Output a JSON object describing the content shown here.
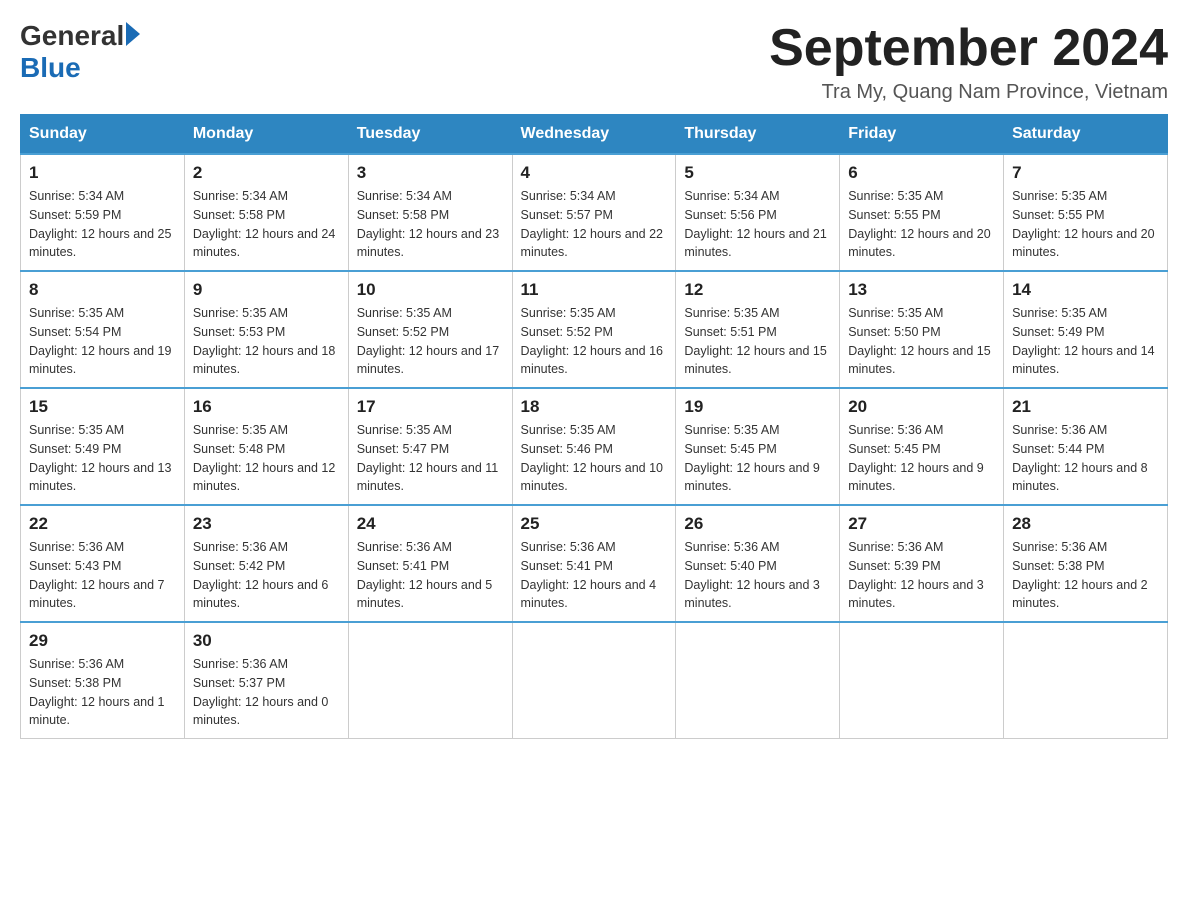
{
  "header": {
    "logo_general": "General",
    "logo_blue": "Blue",
    "month_title": "September 2024",
    "location": "Tra My, Quang Nam Province, Vietnam"
  },
  "days_of_week": [
    "Sunday",
    "Monday",
    "Tuesday",
    "Wednesday",
    "Thursday",
    "Friday",
    "Saturday"
  ],
  "weeks": [
    [
      {
        "day": "1",
        "sunrise": "5:34 AM",
        "sunset": "5:59 PM",
        "daylight": "12 hours and 25 minutes."
      },
      {
        "day": "2",
        "sunrise": "5:34 AM",
        "sunset": "5:58 PM",
        "daylight": "12 hours and 24 minutes."
      },
      {
        "day": "3",
        "sunrise": "5:34 AM",
        "sunset": "5:58 PM",
        "daylight": "12 hours and 23 minutes."
      },
      {
        "day": "4",
        "sunrise": "5:34 AM",
        "sunset": "5:57 PM",
        "daylight": "12 hours and 22 minutes."
      },
      {
        "day": "5",
        "sunrise": "5:34 AM",
        "sunset": "5:56 PM",
        "daylight": "12 hours and 21 minutes."
      },
      {
        "day": "6",
        "sunrise": "5:35 AM",
        "sunset": "5:55 PM",
        "daylight": "12 hours and 20 minutes."
      },
      {
        "day": "7",
        "sunrise": "5:35 AM",
        "sunset": "5:55 PM",
        "daylight": "12 hours and 20 minutes."
      }
    ],
    [
      {
        "day": "8",
        "sunrise": "5:35 AM",
        "sunset": "5:54 PM",
        "daylight": "12 hours and 19 minutes."
      },
      {
        "day": "9",
        "sunrise": "5:35 AM",
        "sunset": "5:53 PM",
        "daylight": "12 hours and 18 minutes."
      },
      {
        "day": "10",
        "sunrise": "5:35 AM",
        "sunset": "5:52 PM",
        "daylight": "12 hours and 17 minutes."
      },
      {
        "day": "11",
        "sunrise": "5:35 AM",
        "sunset": "5:52 PM",
        "daylight": "12 hours and 16 minutes."
      },
      {
        "day": "12",
        "sunrise": "5:35 AM",
        "sunset": "5:51 PM",
        "daylight": "12 hours and 15 minutes."
      },
      {
        "day": "13",
        "sunrise": "5:35 AM",
        "sunset": "5:50 PM",
        "daylight": "12 hours and 15 minutes."
      },
      {
        "day": "14",
        "sunrise": "5:35 AM",
        "sunset": "5:49 PM",
        "daylight": "12 hours and 14 minutes."
      }
    ],
    [
      {
        "day": "15",
        "sunrise": "5:35 AM",
        "sunset": "5:49 PM",
        "daylight": "12 hours and 13 minutes."
      },
      {
        "day": "16",
        "sunrise": "5:35 AM",
        "sunset": "5:48 PM",
        "daylight": "12 hours and 12 minutes."
      },
      {
        "day": "17",
        "sunrise": "5:35 AM",
        "sunset": "5:47 PM",
        "daylight": "12 hours and 11 minutes."
      },
      {
        "day": "18",
        "sunrise": "5:35 AM",
        "sunset": "5:46 PM",
        "daylight": "12 hours and 10 minutes."
      },
      {
        "day": "19",
        "sunrise": "5:35 AM",
        "sunset": "5:45 PM",
        "daylight": "12 hours and 9 minutes."
      },
      {
        "day": "20",
        "sunrise": "5:36 AM",
        "sunset": "5:45 PM",
        "daylight": "12 hours and 9 minutes."
      },
      {
        "day": "21",
        "sunrise": "5:36 AM",
        "sunset": "5:44 PM",
        "daylight": "12 hours and 8 minutes."
      }
    ],
    [
      {
        "day": "22",
        "sunrise": "5:36 AM",
        "sunset": "5:43 PM",
        "daylight": "12 hours and 7 minutes."
      },
      {
        "day": "23",
        "sunrise": "5:36 AM",
        "sunset": "5:42 PM",
        "daylight": "12 hours and 6 minutes."
      },
      {
        "day": "24",
        "sunrise": "5:36 AM",
        "sunset": "5:41 PM",
        "daylight": "12 hours and 5 minutes."
      },
      {
        "day": "25",
        "sunrise": "5:36 AM",
        "sunset": "5:41 PM",
        "daylight": "12 hours and 4 minutes."
      },
      {
        "day": "26",
        "sunrise": "5:36 AM",
        "sunset": "5:40 PM",
        "daylight": "12 hours and 3 minutes."
      },
      {
        "day": "27",
        "sunrise": "5:36 AM",
        "sunset": "5:39 PM",
        "daylight": "12 hours and 3 minutes."
      },
      {
        "day": "28",
        "sunrise": "5:36 AM",
        "sunset": "5:38 PM",
        "daylight": "12 hours and 2 minutes."
      }
    ],
    [
      {
        "day": "29",
        "sunrise": "5:36 AM",
        "sunset": "5:38 PM",
        "daylight": "12 hours and 1 minute."
      },
      {
        "day": "30",
        "sunrise": "5:36 AM",
        "sunset": "5:37 PM",
        "daylight": "12 hours and 0 minutes."
      },
      null,
      null,
      null,
      null,
      null
    ]
  ],
  "labels": {
    "sunrise_prefix": "Sunrise: ",
    "sunset_prefix": "Sunset: ",
    "daylight_prefix": "Daylight: "
  }
}
